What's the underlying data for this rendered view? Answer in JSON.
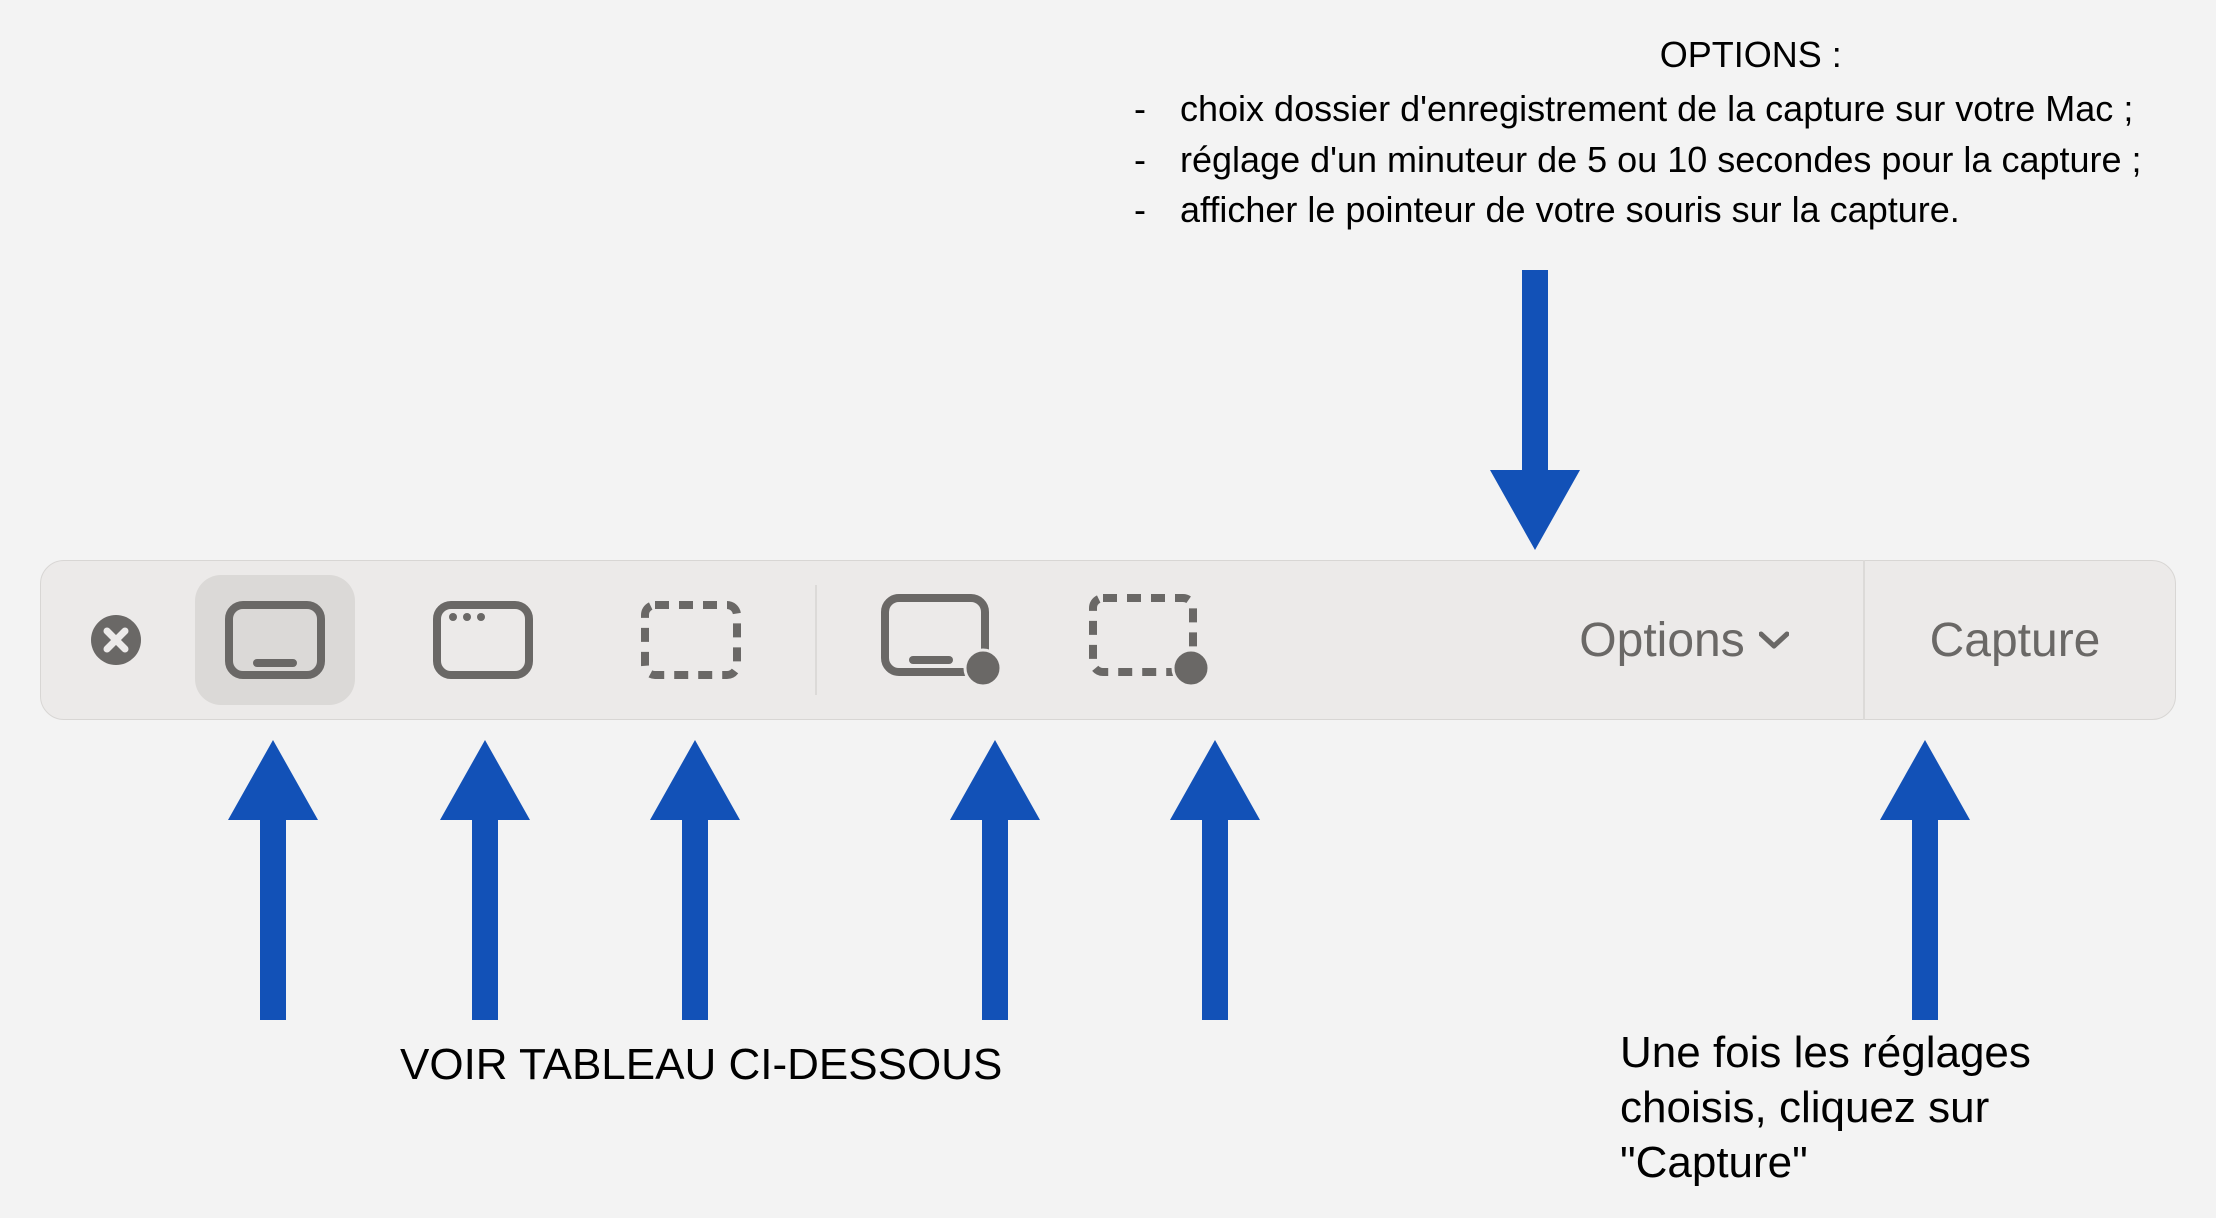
{
  "annotations": {
    "top_heading": "OPTIONS :",
    "top_bullets": [
      "choix dossier d'enregistrement de la capture sur votre Mac ;",
      "réglage d'un minuteur de 5 ou 10 secondes pour la capture ;",
      "afficher le pointeur de votre souris sur la capture."
    ],
    "bottom_left": "VOIR TABLEAU CI-DESSOUS",
    "bottom_right_line1": "Une fois les réglages",
    "bottom_right_line2": "choisis, cliquez sur",
    "bottom_right_line3": "\"Capture\""
  },
  "toolbar": {
    "options_label": "Options",
    "capture_label": "Capture"
  },
  "colors": {
    "arrow": "#1251b7",
    "icon_gray": "#6a6866"
  }
}
